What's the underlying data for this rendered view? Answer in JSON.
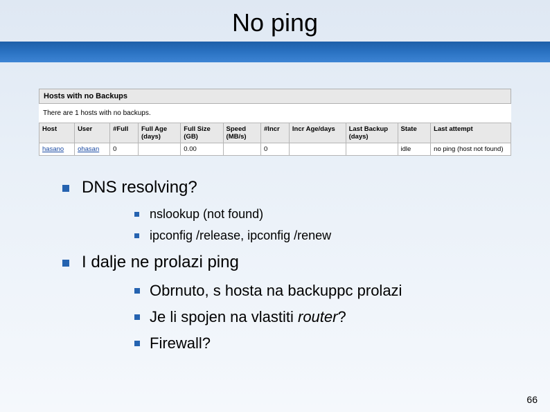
{
  "title": "No ping",
  "table": {
    "banner": "Hosts with no Backups",
    "note": "There are 1 hosts with no backups.",
    "headers": [
      "Host",
      "User",
      "#Full",
      "Full Age (days)",
      "Full Size (GB)",
      "Speed (MB/s)",
      "#Incr",
      "Incr Age/days",
      "Last Backup (days)",
      "State",
      "Last attempt"
    ],
    "row": {
      "host": "hasano",
      "user": "ohasan",
      "nfull": "0",
      "fullage": "",
      "fullsize": "0.00",
      "speed": "",
      "nincr": "0",
      "incrage": "",
      "lastbackup": "",
      "state": "idle",
      "lastattempt": "no ping (host not found)"
    }
  },
  "bullets": {
    "b1": "DNS resolving?",
    "b1a": "nslookup (not found)",
    "b1b": "ipconfig /release, ipconfig /renew",
    "b2": "I dalje ne prolazi ping",
    "b2a": "Obrnuto, s hosta na backuppc prolazi",
    "b2b_pre": "Je li spojen na vlastiti ",
    "b2b_em": "router",
    "b2b_post": "?",
    "b2c": "Firewall?"
  },
  "page_number": "66"
}
